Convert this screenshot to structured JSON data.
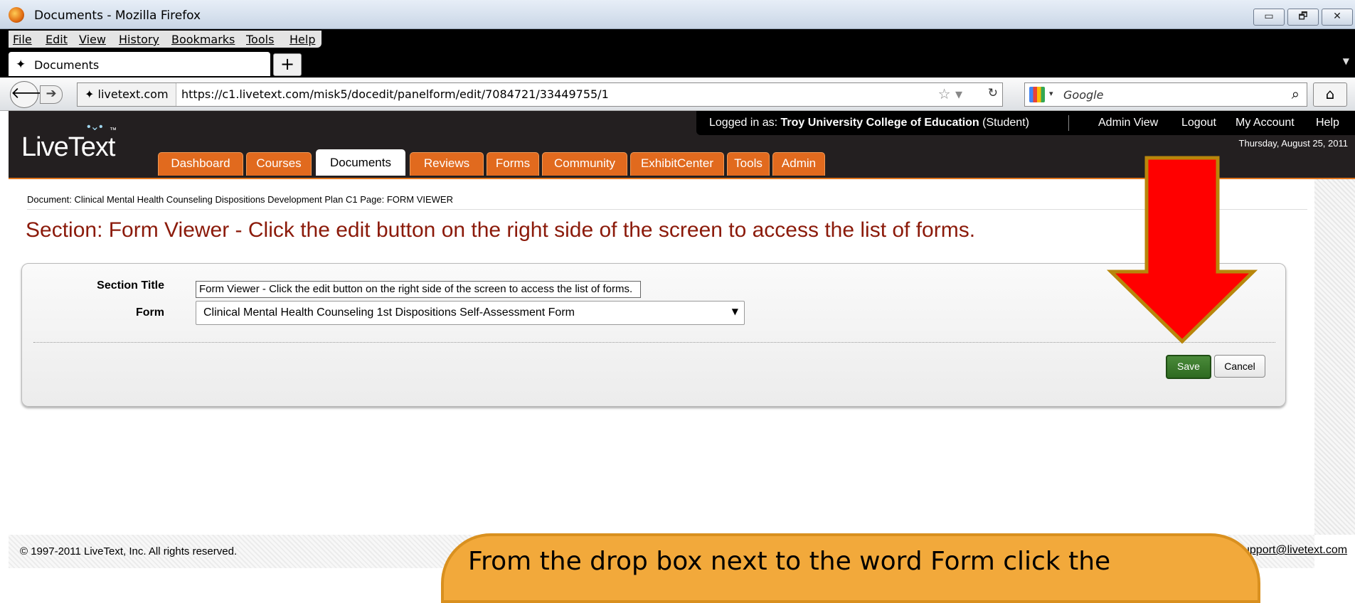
{
  "window": {
    "title": "Documents - Mozilla Firefox",
    "controls": [
      "▭",
      "🗗",
      "✕"
    ]
  },
  "menu": [
    "File",
    "Edit",
    "View",
    "History",
    "Bookmarks",
    "Tools",
    "Help"
  ],
  "tabs": {
    "active_label": "Documents",
    "new_tab": "+"
  },
  "nav": {
    "site": "livetext.com",
    "url": "https://c1.livetext.com/misk5/docedit/panelform/edit/7084721/33449755/1",
    "search_placeholder": "Google",
    "back": "🡐",
    "forward": "➔"
  },
  "header": {
    "logo": "LiveText",
    "logo_tm": "™",
    "login_prefix": "Logged in as: ",
    "login_name": "Troy University College of Education",
    "login_role": " (Student)",
    "links": [
      "Admin View",
      "Logout",
      "My Account",
      "Help"
    ],
    "date": "Thursday, August 25, 2011",
    "tabs": [
      "Dashboard",
      "Courses",
      "Documents",
      "Reviews",
      "Forms",
      "Community",
      "ExhibitCenter",
      "Tools",
      "Admin"
    ],
    "active_tab": "Documents"
  },
  "content": {
    "breadcrumb": "Document: Clinical Mental Health Counseling Dispositions Development Plan C1     Page: FORM VIEWER",
    "section_heading": "Section: Form Viewer - Click the edit button on the right side of the screen to access the list of forms.",
    "fields": {
      "section_title_label": "Section Title",
      "section_title_value": "Form Viewer - Click the edit button on the right side of the screen to access the list of forms.",
      "form_label": "Form",
      "form_value": "Clinical Mental Health Counseling 1st Dispositions Self-Assessment Form"
    },
    "buttons": {
      "save": "Save",
      "cancel": "Cancel"
    }
  },
  "footer": {
    "copyright": "© 1997-2011 LiveText, Inc. All rights reserved.",
    "support": "support@livetext.com"
  },
  "callout": {
    "text": "From the drop box next to the word Form click the",
    "color": "#f2a93b"
  },
  "colors": {
    "accent_orange": "#e16a1e",
    "heading_red": "#8b1a0a",
    "save_green": "#2e6a20",
    "arrow_red": "#ff0000"
  }
}
